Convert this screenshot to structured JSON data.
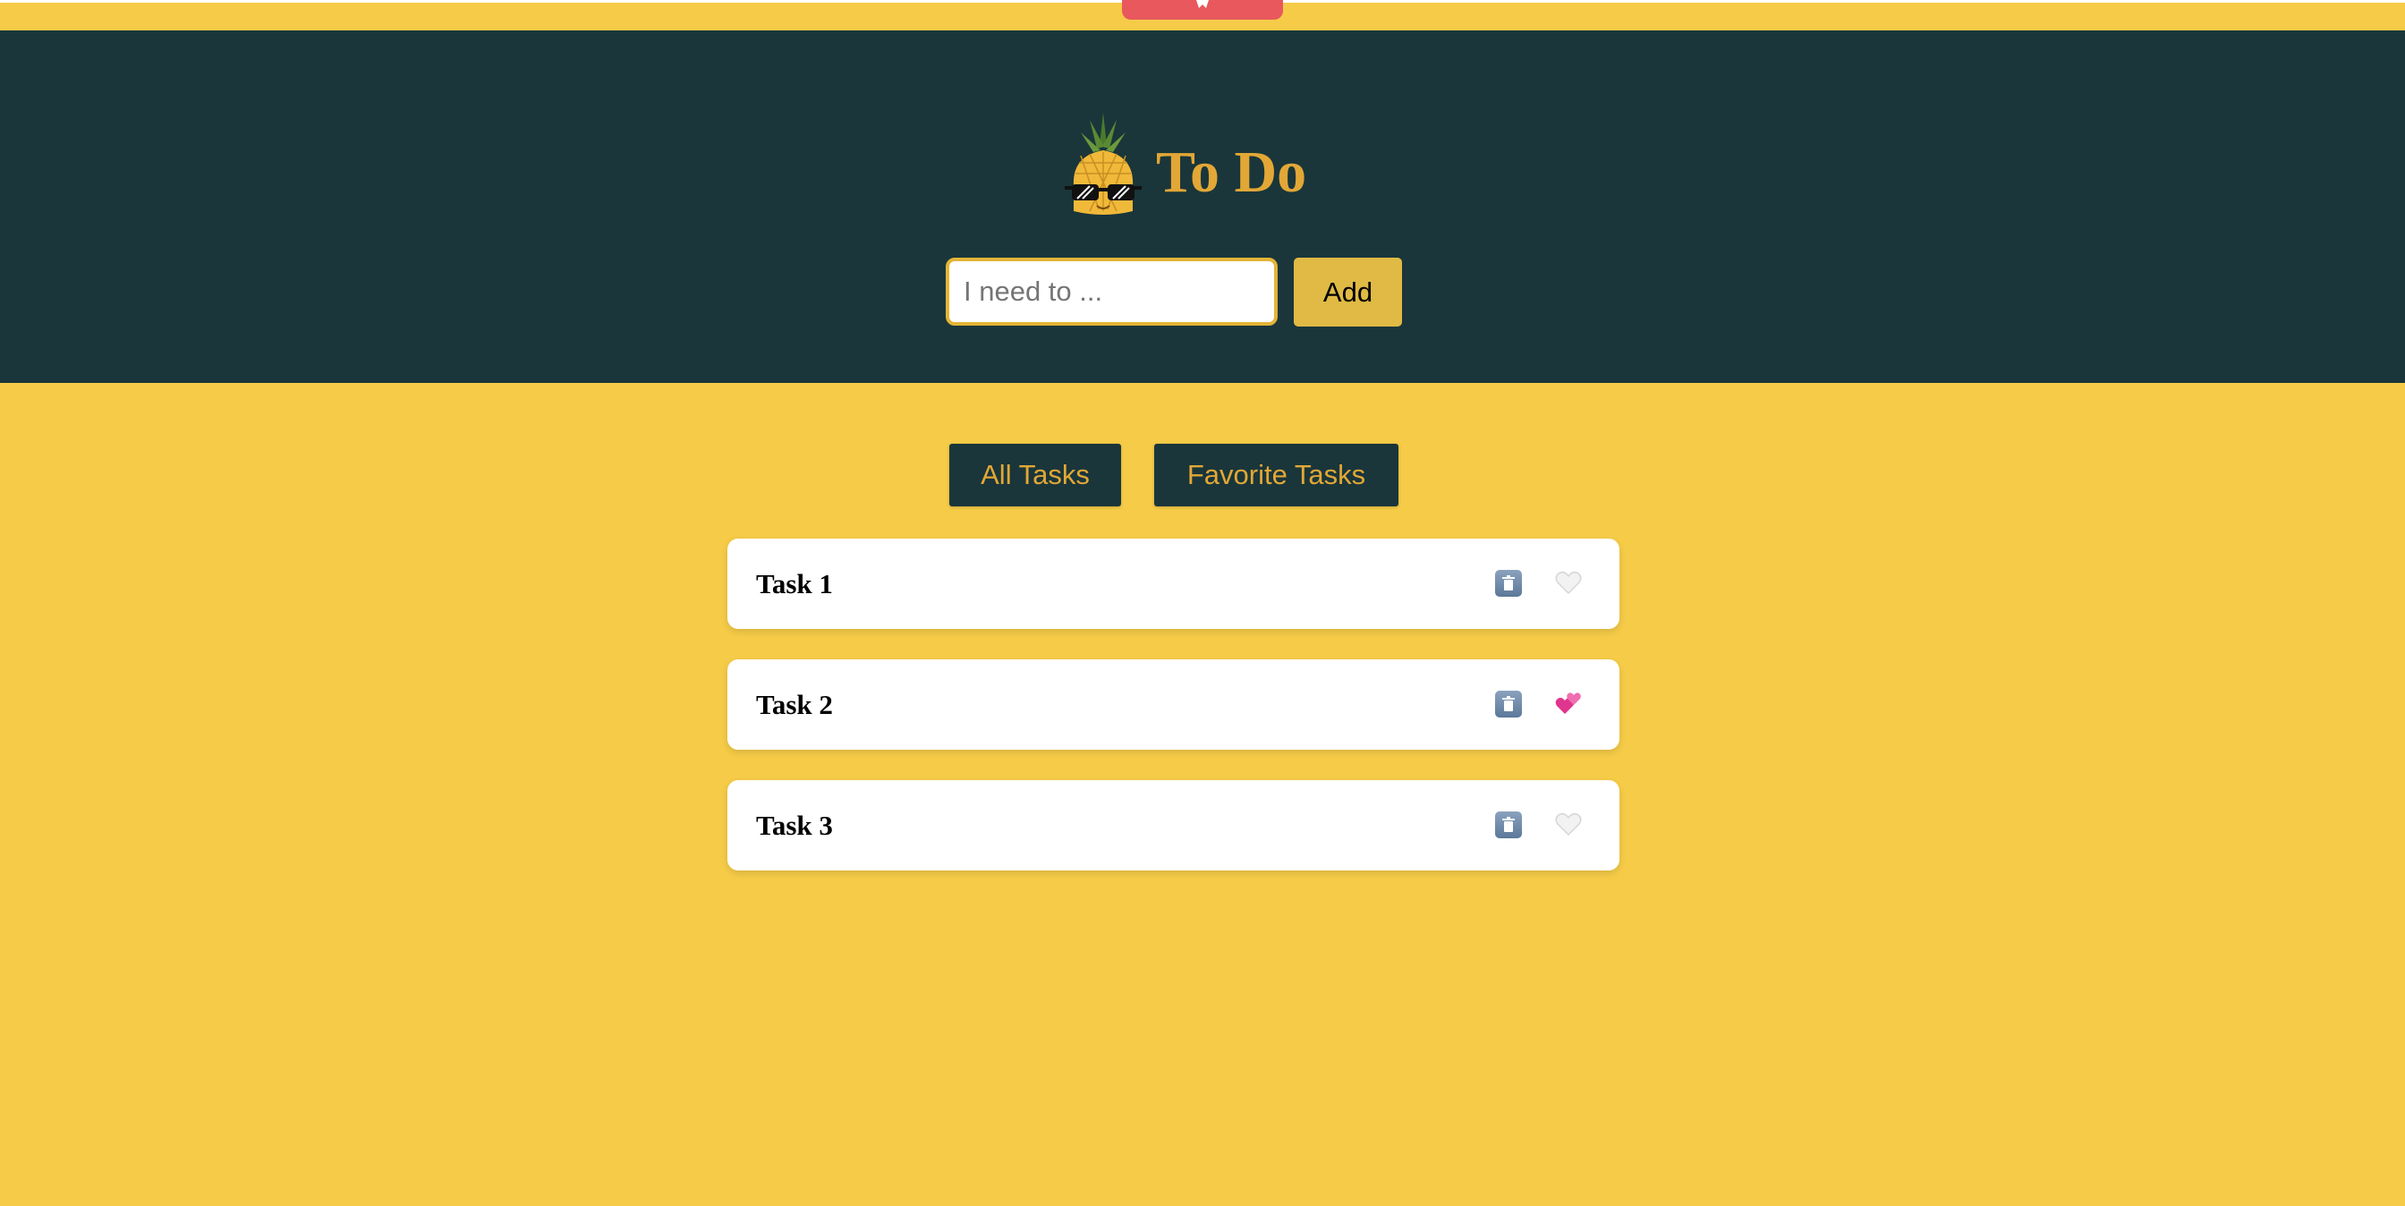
{
  "app": {
    "title": "To Do"
  },
  "input": {
    "placeholder": "I need to ...",
    "value": ""
  },
  "add_button_label": "Add",
  "filters": {
    "all_label": "All Tasks",
    "favorites_label": "Favorite Tasks"
  },
  "tasks": [
    {
      "title": "Task 1",
      "favorite": false,
      "delete_icon": "trash-icon",
      "favorite_icon": "white-heart-icon"
    },
    {
      "title": "Task 2",
      "favorite": true,
      "delete_icon": "trash-icon",
      "favorite_icon": "two-hearts-icon"
    },
    {
      "title": "Task 3",
      "favorite": false,
      "delete_icon": "trash-icon",
      "favorite_icon": "white-heart-icon"
    }
  ],
  "colors": {
    "background": "#f5cb47",
    "header": "#1a363a",
    "accent": "#e2a736",
    "add_button": "#e0ba44",
    "top_tab": "#e8585d",
    "card": "#ffffff"
  },
  "icons": {
    "logo": "pineapple-with-sunglasses-icon",
    "top_tab": "rocket-icon"
  }
}
